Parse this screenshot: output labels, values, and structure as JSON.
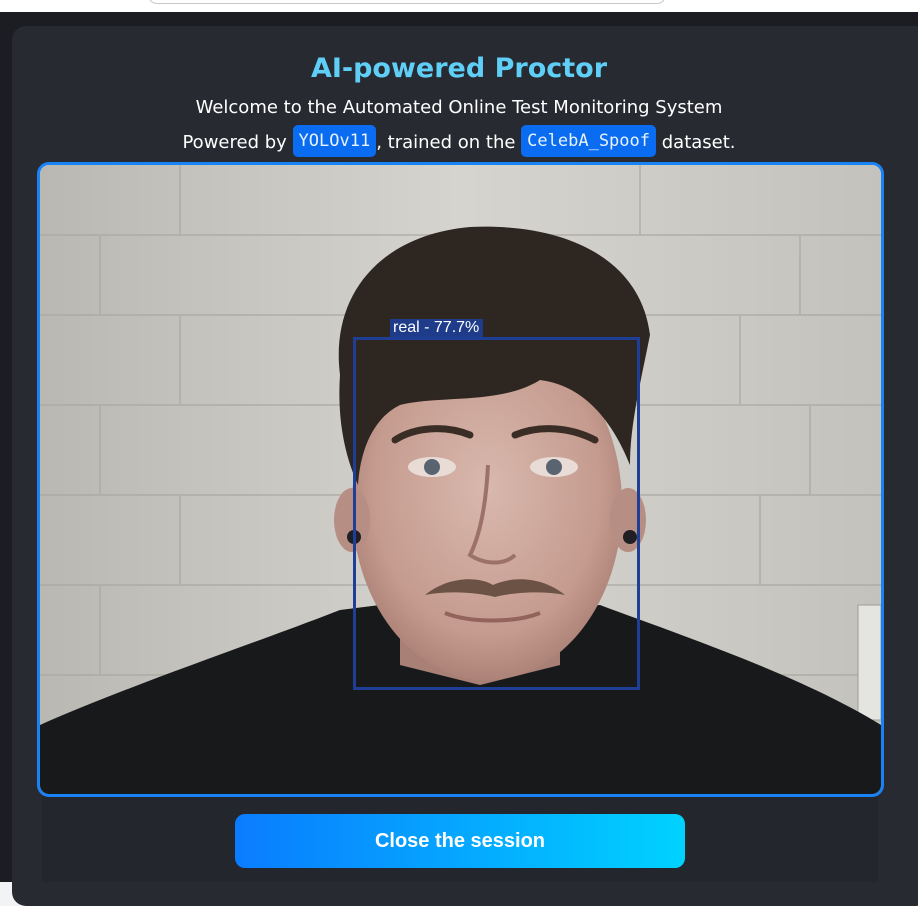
{
  "header": {
    "title": "AI-powered Proctor",
    "welcome": "Welcome to the Automated Online Test Monitoring System",
    "powered_prefix": "Powered by",
    "model_name": "YOLOv11",
    "trained_text": ", trained on the",
    "dataset_name": "CelebA_Spoof",
    "dataset_suffix": "dataset."
  },
  "video": {
    "detection": {
      "label": "real - 77.7%",
      "class": "real",
      "confidence_percent": 77.7
    }
  },
  "actions": {
    "close_label": "Close the session"
  },
  "colors": {
    "title": "#5fcff7",
    "accent_border": "#1a82f7",
    "chip_bg": "#0a6cf0",
    "button_gradient_start": "#0a7cff",
    "button_gradient_end": "#00d2ff",
    "detection_box": "#1f3f96"
  }
}
